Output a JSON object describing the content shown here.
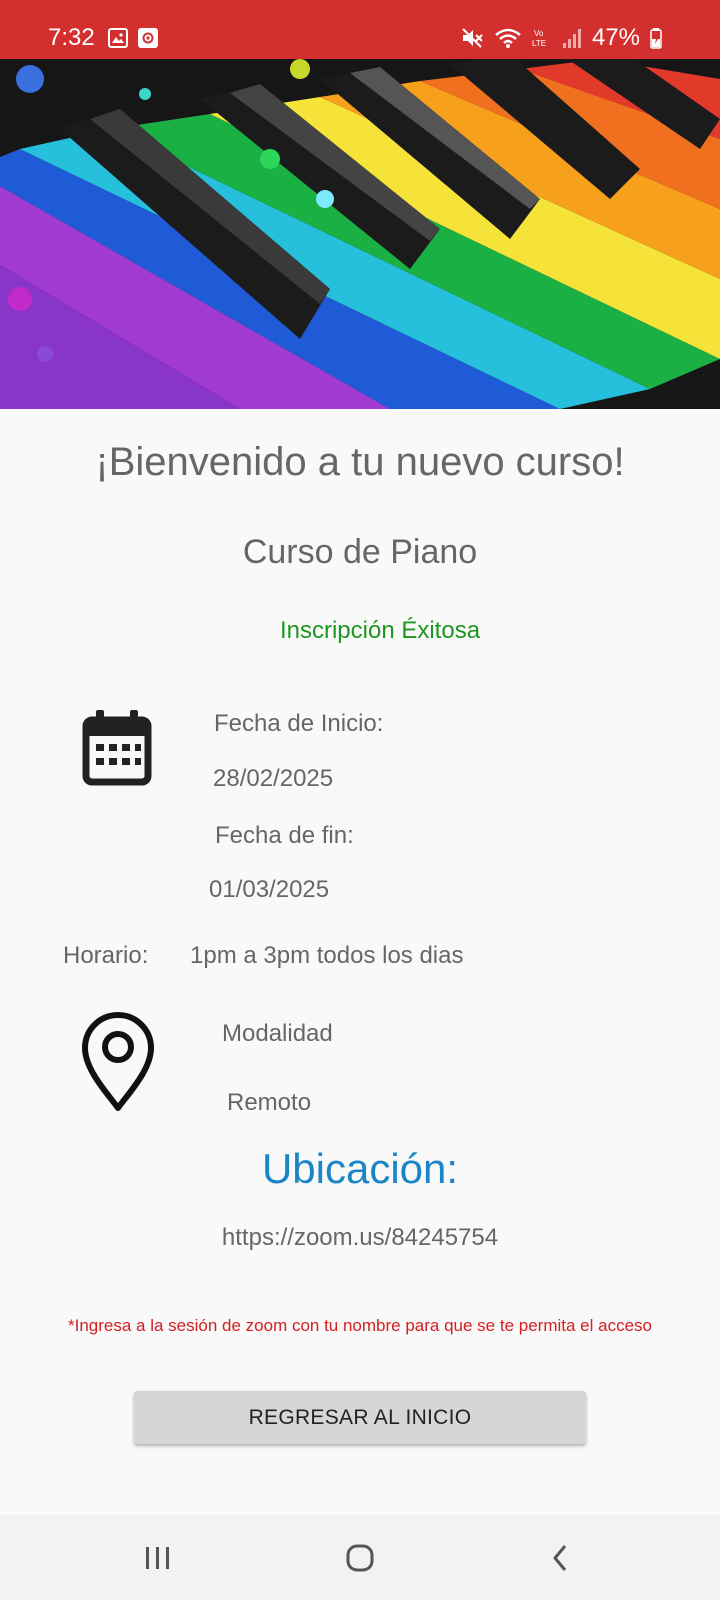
{
  "status_bar": {
    "time": "7:32",
    "battery": "47%",
    "icons": [
      "gallery-icon",
      "record-icon",
      "mute-icon",
      "wifi-icon",
      "volte-icon",
      "signal-icon",
      "battery-icon"
    ]
  },
  "hero": {
    "icon": "rainbow-piano-keys-image"
  },
  "content": {
    "title": "¡Bienvenido a tu nuevo curso!",
    "course_name": "Curso de Piano",
    "status": "Inscripción Éxitosa",
    "start_label": "Fecha de Inicio:",
    "start_date": "28/02/2025",
    "end_label": "Fecha de fin:",
    "end_date": "01/03/2025",
    "schedule_label": "Horario:",
    "schedule_value": "1pm a 3pm todos los dias",
    "mode_label": "Modalidad",
    "mode_value": "Remoto",
    "location_title": "Ubicación:",
    "location_link": "https://zoom.us/84245754",
    "note": "*Ingresa a la sesión de zoom con tu nombre para que se te permita el acceso",
    "back_button": "REGRESAR AL INICIO"
  },
  "colors": {
    "status_bar": "#d32f2f",
    "success": "#1e9620",
    "link_title": "#1a86c7",
    "note": "#d32020",
    "button": "#d6d6d6"
  },
  "nav": {
    "icons": [
      "recents-icon",
      "home-icon",
      "back-icon"
    ]
  }
}
